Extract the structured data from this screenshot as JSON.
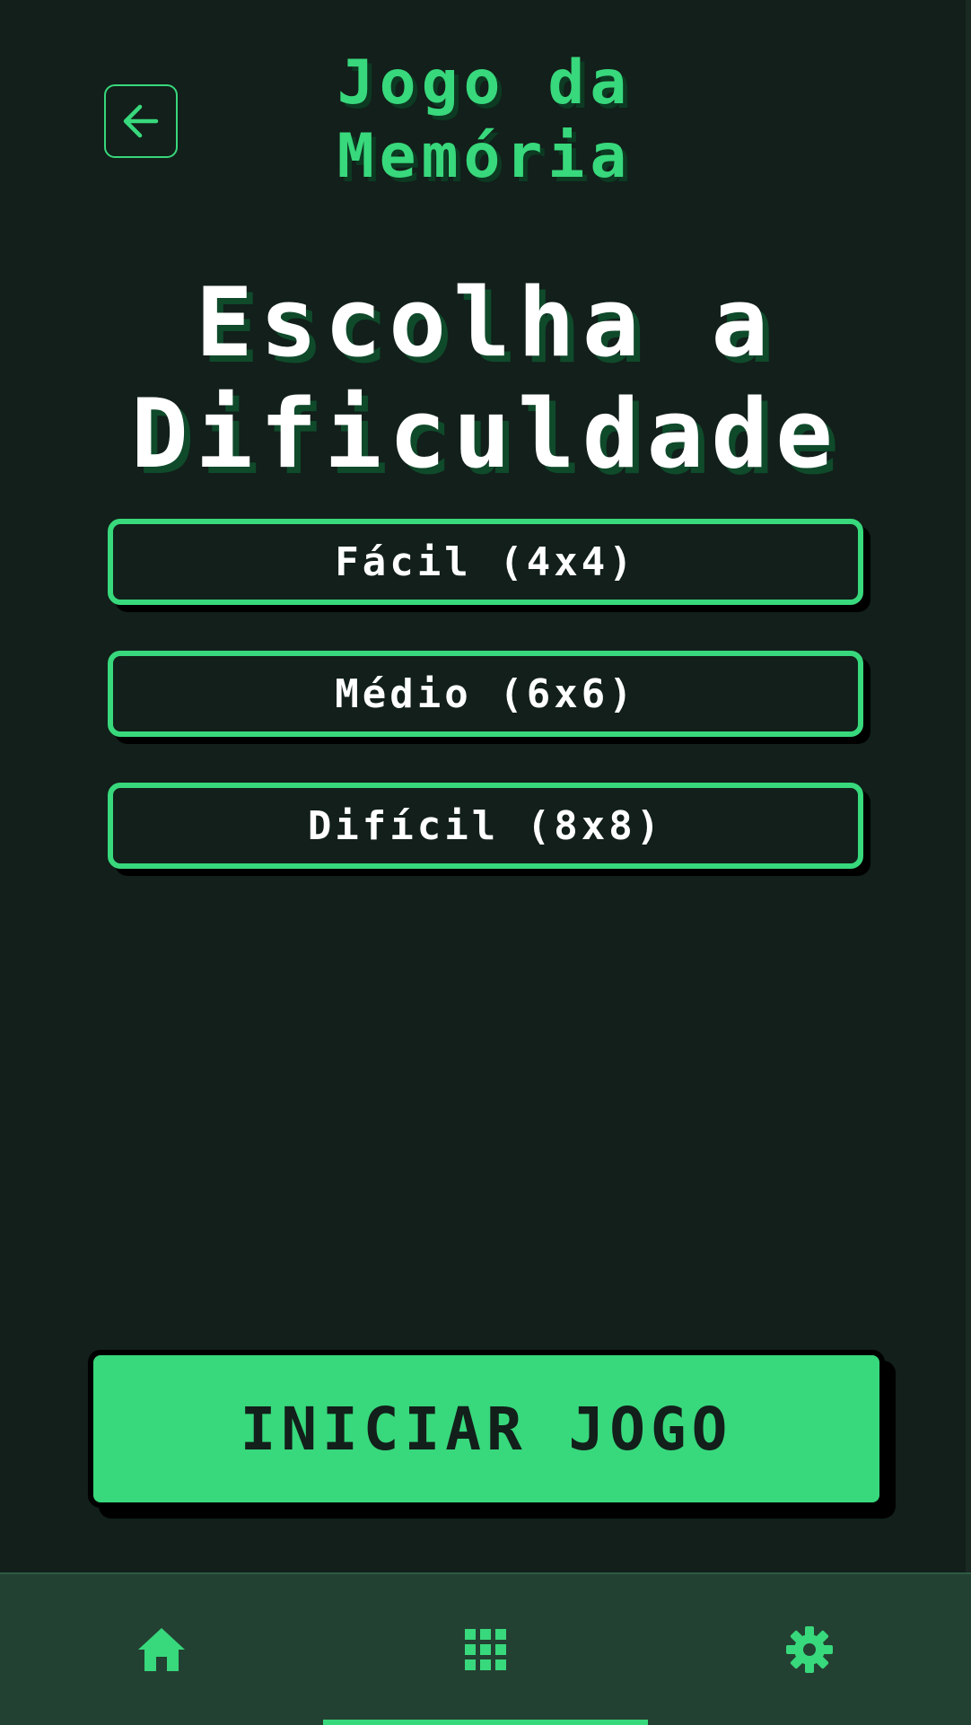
{
  "header": {
    "back_icon": "arrow-left-icon",
    "title": "Jogo da\nMemória"
  },
  "main": {
    "heading": "Escolha a\nDificuldade",
    "options": [
      {
        "label": "Fácil (4x4)"
      },
      {
        "label": "Médio (6x6)"
      },
      {
        "label": "Difícil (8x8)"
      }
    ],
    "start_label": "INICIAR JOGO"
  },
  "bottom_nav": {
    "items": [
      {
        "icon": "home-icon"
      },
      {
        "icon": "grid-icon",
        "active": true
      },
      {
        "icon": "gear-icon"
      }
    ]
  },
  "colors": {
    "background": "#121f1a",
    "accent": "#38d87c",
    "nav_background": "#234132",
    "text": "#ffffff"
  }
}
